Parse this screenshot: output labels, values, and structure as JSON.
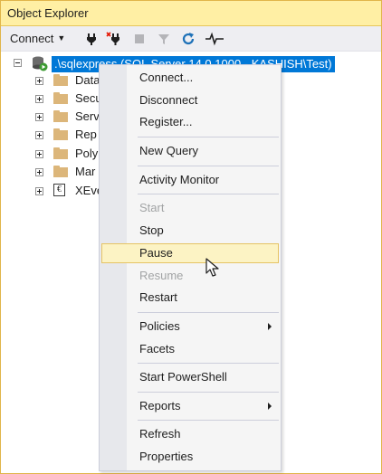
{
  "window": {
    "title": "Object Explorer"
  },
  "toolbar": {
    "connect_label": "Connect",
    "icons": [
      "connect-plug-icon",
      "disconnect-icon",
      "stop-icon",
      "filter-icon",
      "refresh-icon",
      "activity-monitor-icon"
    ]
  },
  "tree": {
    "server_label": ".\\sqlexpress (SQL Server 14.0.1000 - KASHISH\\Test)",
    "items": [
      {
        "label": "Data"
      },
      {
        "label": "Secu"
      },
      {
        "label": "Serv"
      },
      {
        "label": "Rep"
      },
      {
        "label": "Poly"
      },
      {
        "label": "Mar"
      },
      {
        "label": "XEve"
      }
    ]
  },
  "context_menu": {
    "items": [
      {
        "label": "Connect..."
      },
      {
        "label": "Disconnect"
      },
      {
        "label": "Register..."
      },
      {
        "label": "New Query"
      },
      {
        "label": "Activity Monitor"
      },
      {
        "label": "Start",
        "disabled": true
      },
      {
        "label": "Stop"
      },
      {
        "label": "Pause",
        "highlighted": true
      },
      {
        "label": "Resume",
        "disabled": true
      },
      {
        "label": "Restart"
      },
      {
        "label": "Policies",
        "submenu": true
      },
      {
        "label": "Facets"
      },
      {
        "label": "Start PowerShell"
      },
      {
        "label": "Reports",
        "submenu": true
      },
      {
        "label": "Refresh"
      },
      {
        "label": "Properties"
      }
    ]
  },
  "colors": {
    "title_bg": "#ffefa4",
    "selection": "#0078d7",
    "menu_hover": "#fcf3c4",
    "folder": "#dcb67a",
    "disabled_text": "#a2a4a5"
  }
}
